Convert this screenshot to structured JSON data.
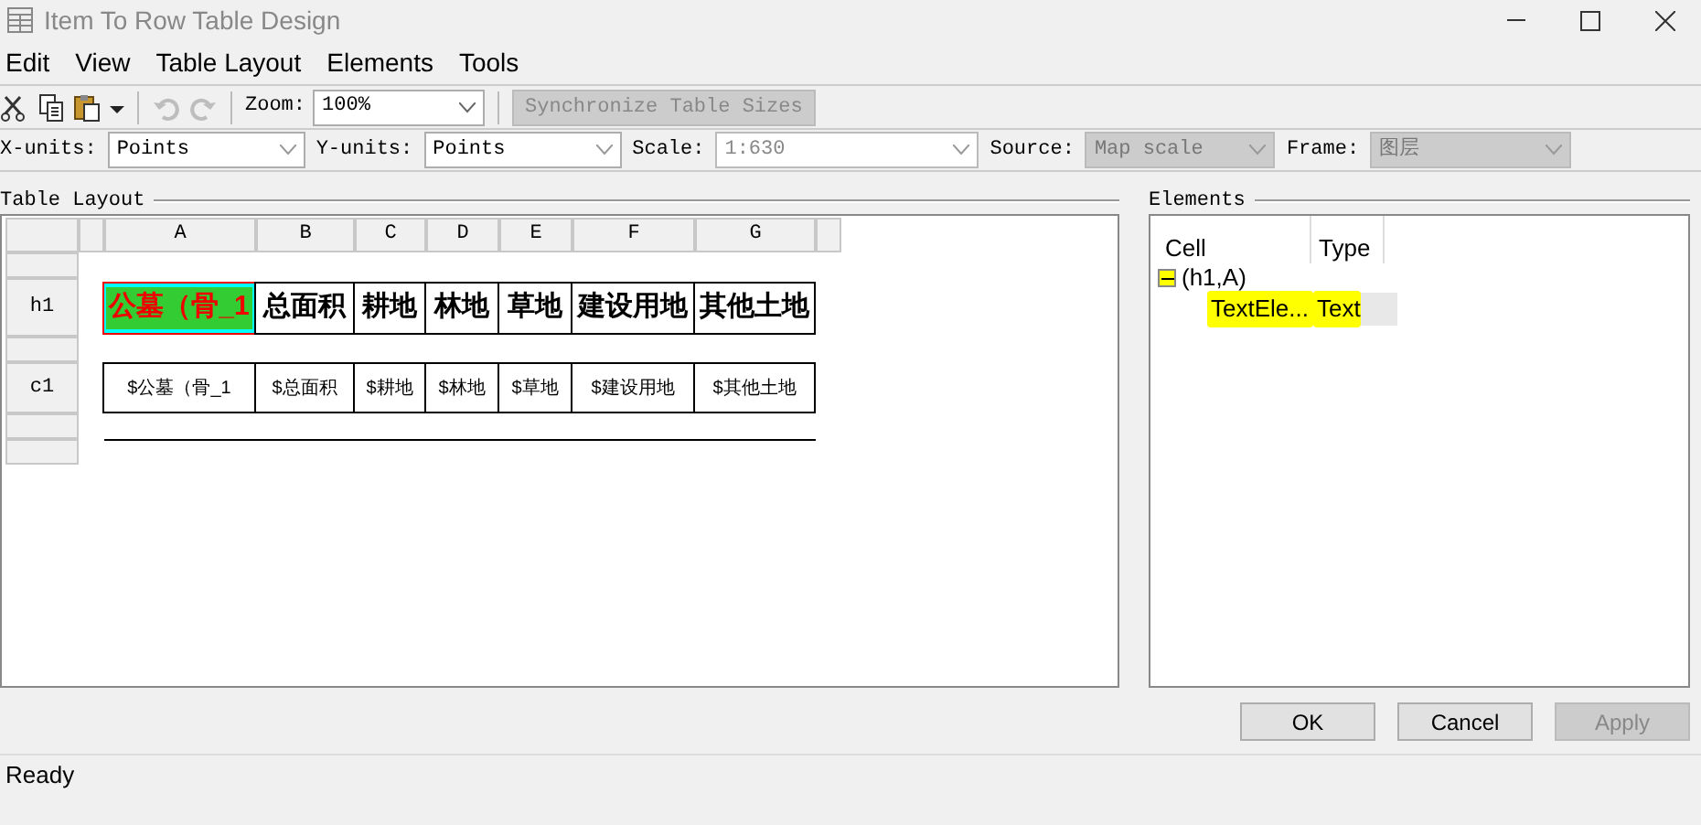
{
  "window": {
    "title": "Item To Row Table Design"
  },
  "menu": [
    "Edit",
    "View",
    "Table Layout",
    "Elements",
    "Tools"
  ],
  "toolbar": {
    "tools": [
      {
        "kind": "cut"
      },
      {
        "kind": "copy"
      },
      {
        "kind": "paste"
      },
      {
        "kind": "undo",
        "disabled": true
      },
      {
        "kind": "redo",
        "disabled": true
      }
    ],
    "zoom_label": "Zoom:",
    "zoom_value": "100%",
    "sync_button": {
      "label": "Synchronize Table Sizes",
      "disabled": true
    }
  },
  "units": [
    {
      "label": "X-units:",
      "value": "Points",
      "disabled": false,
      "kind": "select"
    },
    {
      "label": "Y-units:",
      "value": "Points",
      "disabled": false,
      "kind": "select"
    },
    {
      "label": "Scale:",
      "value": "1:630",
      "disabled": true,
      "kind": "combo"
    },
    {
      "label": "Source:",
      "value": "Map scale",
      "disabled": true,
      "kind": "select"
    },
    {
      "label": "Frame:",
      "value": "图层",
      "disabled": true,
      "kind": "select"
    }
  ],
  "table_layout": {
    "title": "Table Layout",
    "columns": [
      "A",
      "B",
      "C",
      "D",
      "E",
      "F",
      "G"
    ],
    "rows": [
      {
        "header": "h1",
        "kind": "title",
        "cells": [
          {
            "text": "公墓（骨_1",
            "selected": true
          },
          {
            "text": "总面积",
            "selected": false
          },
          {
            "text": "耕地",
            "selected": false
          },
          {
            "text": "林地",
            "selected": false
          },
          {
            "text": "草地",
            "selected": false
          },
          {
            "text": "建设用地",
            "selected": false
          },
          {
            "text": "其他土地",
            "selected": false
          }
        ]
      },
      {
        "header": "c1",
        "kind": "content",
        "cells": [
          {
            "text": "$公墓（骨_1",
            "selected": false
          },
          {
            "text": "$总面积",
            "selected": false
          },
          {
            "text": "$耕地",
            "selected": false
          },
          {
            "text": "$林地",
            "selected": false
          },
          {
            "text": "$草地",
            "selected": false
          },
          {
            "text": "$建设用地",
            "selected": false
          },
          {
            "text": "$其他土地",
            "selected": false
          }
        ]
      }
    ]
  },
  "elements": {
    "title": "Elements",
    "columns": [
      "Cell",
      "Type"
    ],
    "tree": [
      {
        "cell": "(h1,A)",
        "expanded": true,
        "highlighted": true,
        "children": [
          {
            "cell": "TextEle...",
            "type": "Text",
            "highlighted": true,
            "selected": true
          }
        ]
      }
    ]
  },
  "buttons": [
    {
      "label": "OK",
      "disabled": false
    },
    {
      "label": "Cancel",
      "disabled": false
    },
    {
      "label": "Apply",
      "disabled": true
    }
  ],
  "status_bar": "Ready"
}
